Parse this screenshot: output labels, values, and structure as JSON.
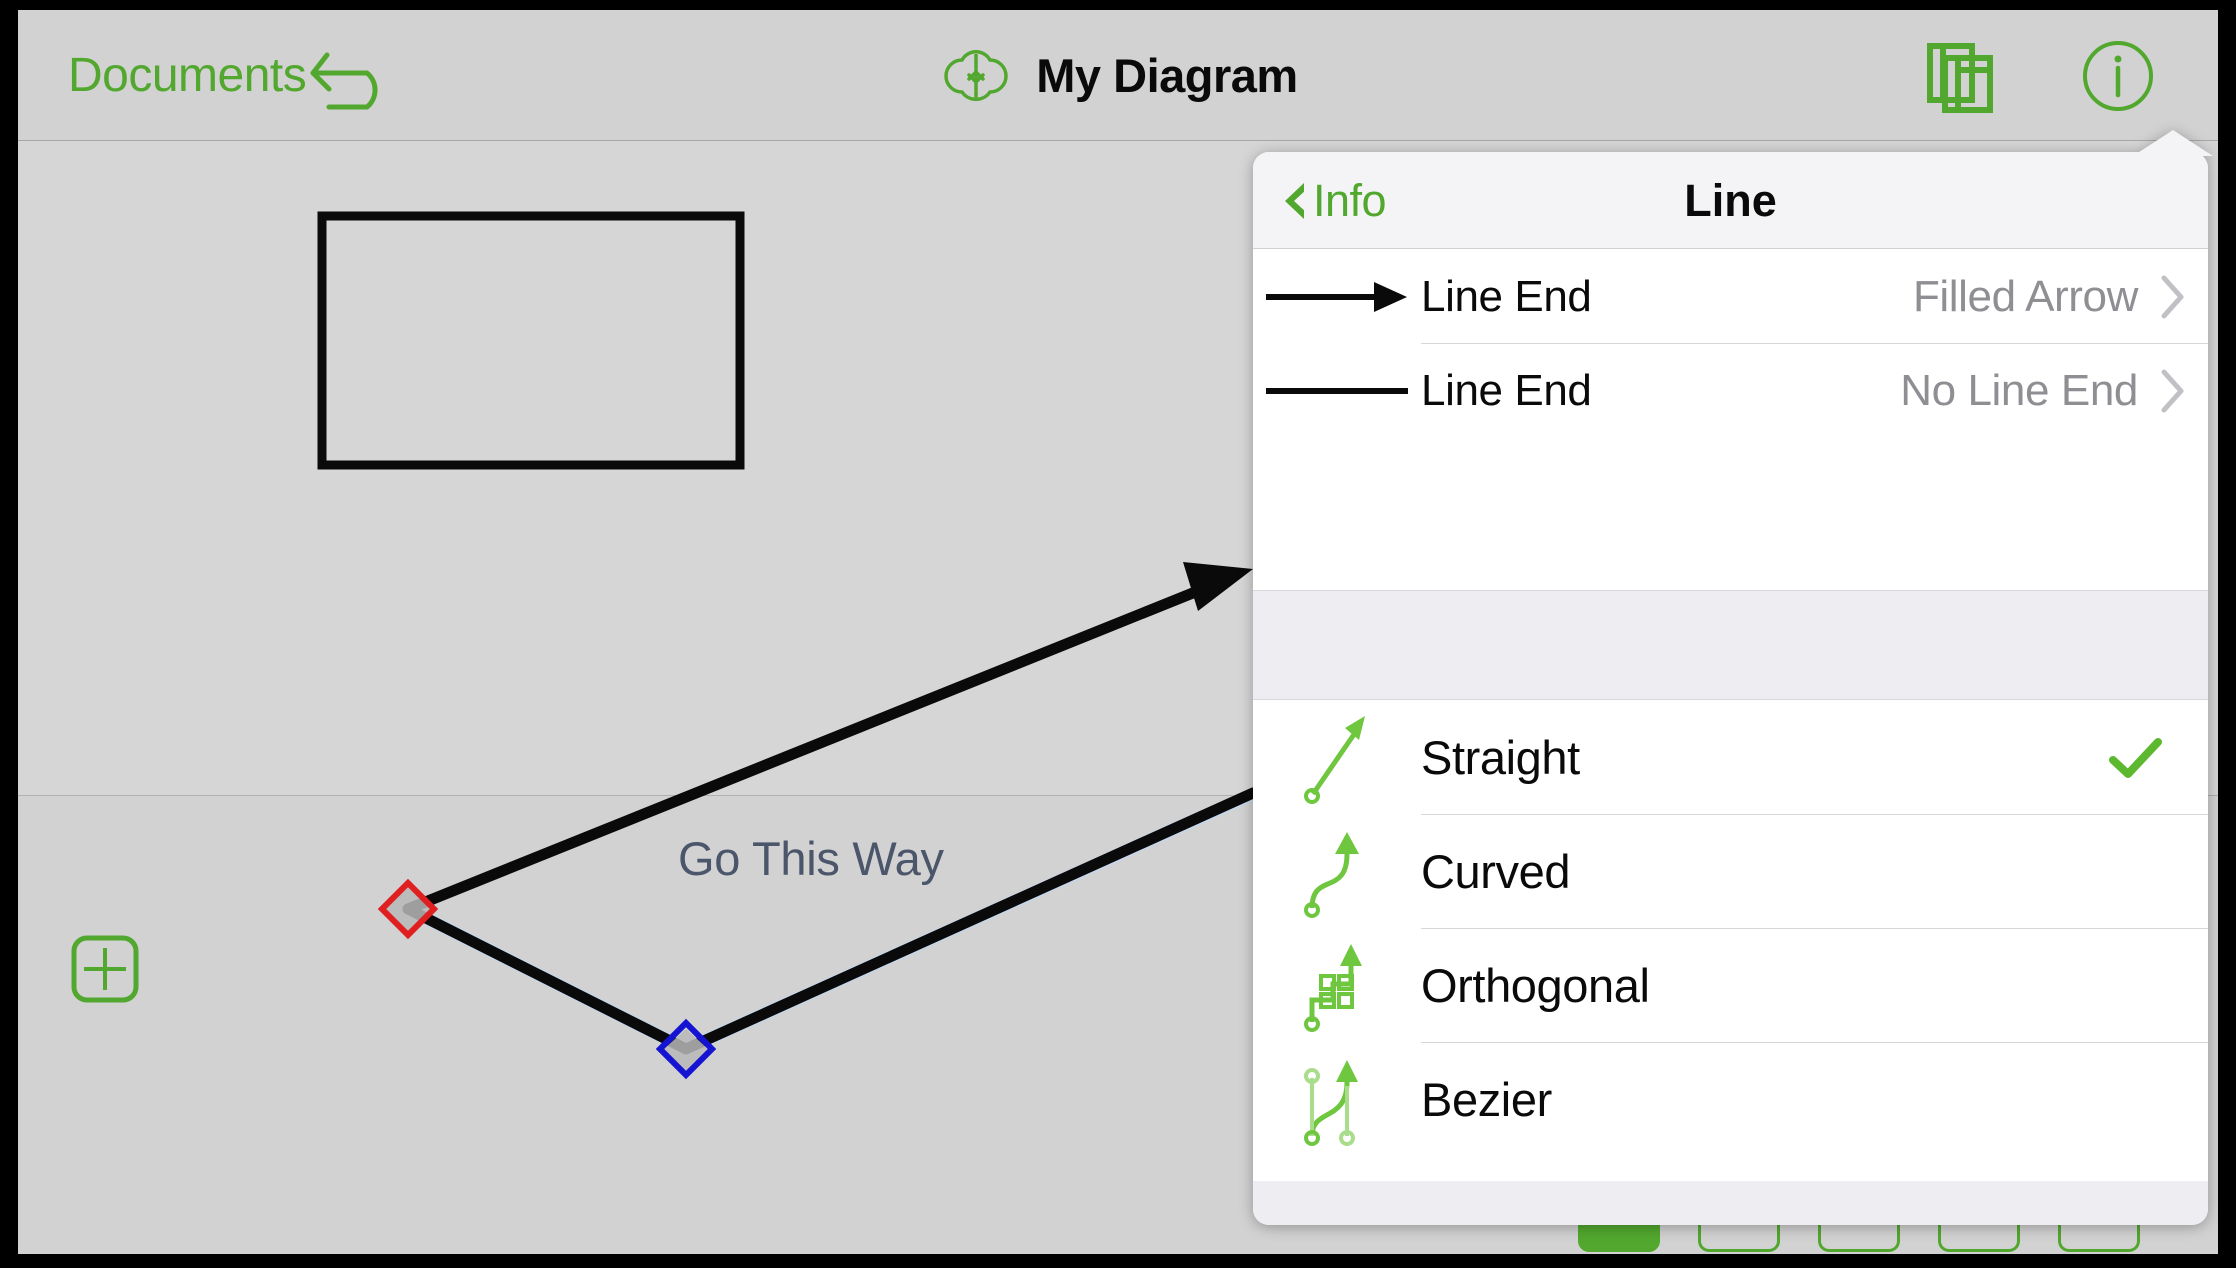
{
  "app": {
    "accent_green": "#52a82e",
    "canvas_bg": "#d6d6d6",
    "toolbar_bg": "#d2d2d2"
  },
  "toolbar": {
    "back_label": "Documents",
    "undo_icon": "undo-arrow-icon",
    "sync_icon": "cloud-sync-icon",
    "title": "My Diagram",
    "pages_icon": "pages-stack-icon",
    "info_icon": "info-circle-icon"
  },
  "canvas": {
    "add_shape_icon": "plus-square-icon",
    "shapes": [
      {
        "type": "rectangle",
        "name": "diagram-rectangle"
      }
    ],
    "connection_label": "Go This Way",
    "label_color": "#4b566b",
    "handles": [
      {
        "name": "line-handle-start",
        "color": "#e02020",
        "shape": "diamond"
      },
      {
        "name": "line-handle-midpoint",
        "color": "#1414d2",
        "shape": "diamond"
      }
    ]
  },
  "bottom_bar": {
    "segments": [
      {
        "name": "segment-1",
        "active": true
      },
      {
        "name": "segment-2",
        "active": false
      },
      {
        "name": "segment-3",
        "active": false
      },
      {
        "name": "segment-4",
        "active": false
      },
      {
        "name": "segment-5",
        "active": false
      }
    ]
  },
  "popover": {
    "back_label": "Info",
    "title": "Line",
    "line_end_rows": [
      {
        "icon": "line-with-filled-arrow-icon",
        "label": "Line End",
        "value": "Filled Arrow",
        "has_arrow_head": true
      },
      {
        "icon": "plain-line-icon",
        "label": "Line End",
        "value": "No Line End",
        "has_arrow_head": false
      }
    ],
    "line_styles": [
      {
        "icon": "straight-line-icon",
        "label": "Straight",
        "selected": true
      },
      {
        "icon": "curved-line-icon",
        "label": "Curved",
        "selected": false
      },
      {
        "icon": "orthogonal-line-icon",
        "label": "Orthogonal",
        "selected": false
      },
      {
        "icon": "bezier-line-icon",
        "label": "Bezier",
        "selected": false
      }
    ],
    "checkmark_color": "#5cb82e",
    "chevron_color": "#c0c0c5"
  }
}
